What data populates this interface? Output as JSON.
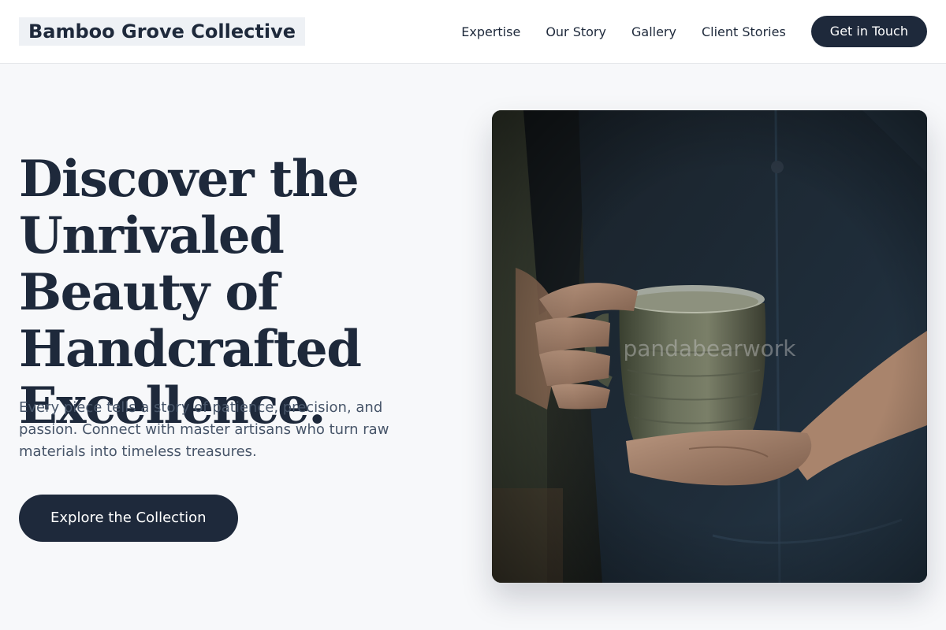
{
  "header": {
    "logo": "Bamboo Grove Collective",
    "nav": [
      {
        "label": "Expertise"
      },
      {
        "label": "Our Story"
      },
      {
        "label": "Gallery"
      },
      {
        "label": "Client Stories"
      }
    ],
    "cta_label": "Get in Touch"
  },
  "hero": {
    "title": "Discover the Unrivaled Beauty of Handcrafted Excellence.",
    "description": "Every piece tells a story of patience, precision, and passion. Connect with master artisans who turn raw materials into timeless treasures.",
    "cta_label": "Explore the Collection",
    "image": {
      "subject": "artisan-holding-ceramic-mug",
      "watermark": "pandabearwork"
    }
  },
  "colors": {
    "primary": "#1e293b",
    "background": "#f7f8fa",
    "text_muted": "#475569",
    "logo_bg": "#eef1f5"
  }
}
